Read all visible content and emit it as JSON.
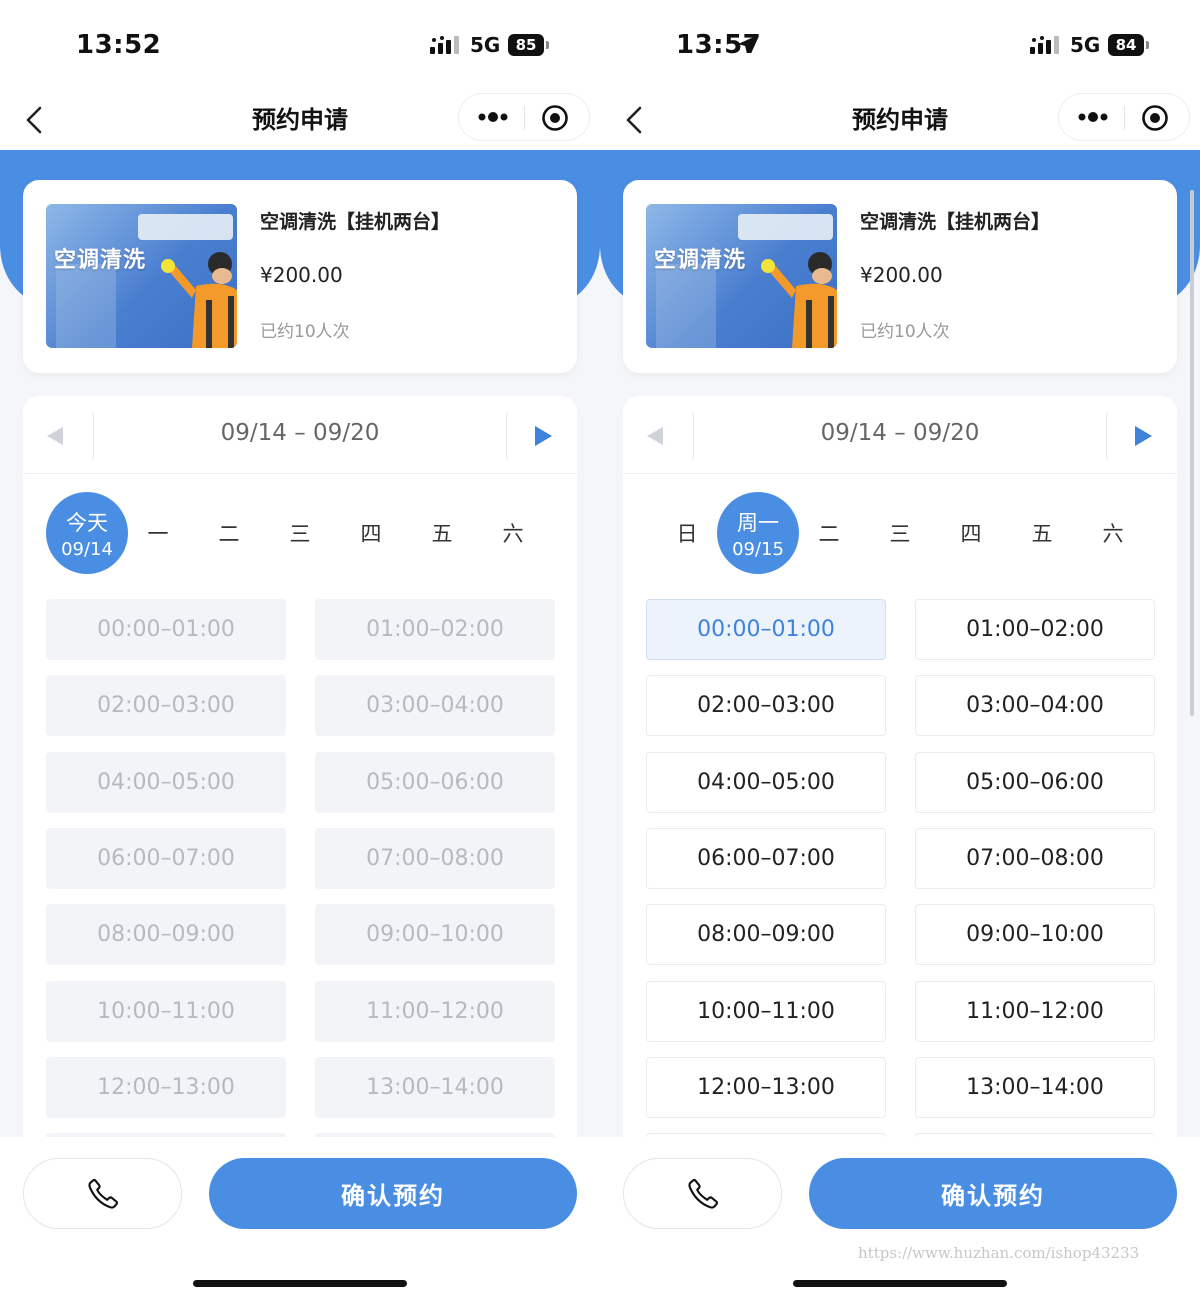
{
  "screens": [
    {
      "status": {
        "time": "13:52",
        "network": "5G",
        "battery": "85",
        "show_location": false
      },
      "nav": {
        "title": "预约申请"
      },
      "product": {
        "image_label": "空调清洗",
        "name": "空调清洗【挂机两台】",
        "price": "¥200.00",
        "booked": "已约10人次"
      },
      "calendar": {
        "week_range": "09/14 – 09/20",
        "days": [
          {
            "label": "今天",
            "date": "09/14",
            "selected": true
          },
          {
            "label": "一",
            "date": "",
            "selected": false
          },
          {
            "label": "二",
            "date": "",
            "selected": false
          },
          {
            "label": "三",
            "date": "",
            "selected": false
          },
          {
            "label": "四",
            "date": "",
            "selected": false
          },
          {
            "label": "五",
            "date": "",
            "selected": false
          },
          {
            "label": "六",
            "date": "",
            "selected": false
          }
        ],
        "slots": [
          {
            "time": "00:00–01:00",
            "state": "disabled"
          },
          {
            "time": "01:00–02:00",
            "state": "disabled"
          },
          {
            "time": "02:00–03:00",
            "state": "disabled"
          },
          {
            "time": "03:00–04:00",
            "state": "disabled"
          },
          {
            "time": "04:00–05:00",
            "state": "disabled"
          },
          {
            "time": "05:00–06:00",
            "state": "disabled"
          },
          {
            "time": "06:00–07:00",
            "state": "disabled"
          },
          {
            "time": "07:00–08:00",
            "state": "disabled"
          },
          {
            "time": "08:00–09:00",
            "state": "disabled"
          },
          {
            "time": "09:00–10:00",
            "state": "disabled"
          },
          {
            "time": "10:00–11:00",
            "state": "disabled"
          },
          {
            "time": "11:00–12:00",
            "state": "disabled"
          },
          {
            "time": "12:00–13:00",
            "state": "disabled"
          },
          {
            "time": "13:00–14:00",
            "state": "disabled"
          }
        ]
      },
      "footer": {
        "confirm_label": "确认预约",
        "watermark": ""
      },
      "show_scrollbar": false
    },
    {
      "status": {
        "time": "13:57",
        "network": "5G",
        "battery": "84",
        "show_location": true
      },
      "nav": {
        "title": "预约申请"
      },
      "product": {
        "image_label": "空调清洗",
        "name": "空调清洗【挂机两台】",
        "price": "¥200.00",
        "booked": "已约10人次"
      },
      "calendar": {
        "week_range": "09/14 – 09/20",
        "days": [
          {
            "label": "日",
            "date": "",
            "selected": false
          },
          {
            "label": "周一",
            "date": "09/15",
            "selected": true
          },
          {
            "label": "二",
            "date": "",
            "selected": false
          },
          {
            "label": "三",
            "date": "",
            "selected": false
          },
          {
            "label": "四",
            "date": "",
            "selected": false
          },
          {
            "label": "五",
            "date": "",
            "selected": false
          },
          {
            "label": "六",
            "date": "",
            "selected": false
          }
        ],
        "slots": [
          {
            "time": "00:00–01:00",
            "state": "active"
          },
          {
            "time": "01:00–02:00",
            "state": "available"
          },
          {
            "time": "02:00–03:00",
            "state": "available"
          },
          {
            "time": "03:00–04:00",
            "state": "available"
          },
          {
            "time": "04:00–05:00",
            "state": "available"
          },
          {
            "time": "05:00–06:00",
            "state": "available"
          },
          {
            "time": "06:00–07:00",
            "state": "available"
          },
          {
            "time": "07:00–08:00",
            "state": "available"
          },
          {
            "time": "08:00–09:00",
            "state": "available"
          },
          {
            "time": "09:00–10:00",
            "state": "available"
          },
          {
            "time": "10:00–11:00",
            "state": "available"
          },
          {
            "time": "11:00–12:00",
            "state": "available"
          },
          {
            "time": "12:00–13:00",
            "state": "available"
          },
          {
            "time": "13:00–14:00",
            "state": "available"
          }
        ]
      },
      "footer": {
        "confirm_label": "确认预约",
        "watermark": "https://www.huzhan.com/ishop43233"
      },
      "show_scrollbar": true
    }
  ],
  "colors": {
    "accent": "#4a8ee4",
    "disabled_bg": "#f2f4f7",
    "disabled_text": "#b5bac2",
    "active_bg": "#ecf3fc",
    "active_text": "#3f82dc"
  },
  "icons": [
    "back-icon",
    "more-icon",
    "close-target-icon",
    "prev-arrow-icon",
    "next-arrow-icon",
    "phone-icon",
    "location-arrow-icon",
    "signal-icon"
  ]
}
